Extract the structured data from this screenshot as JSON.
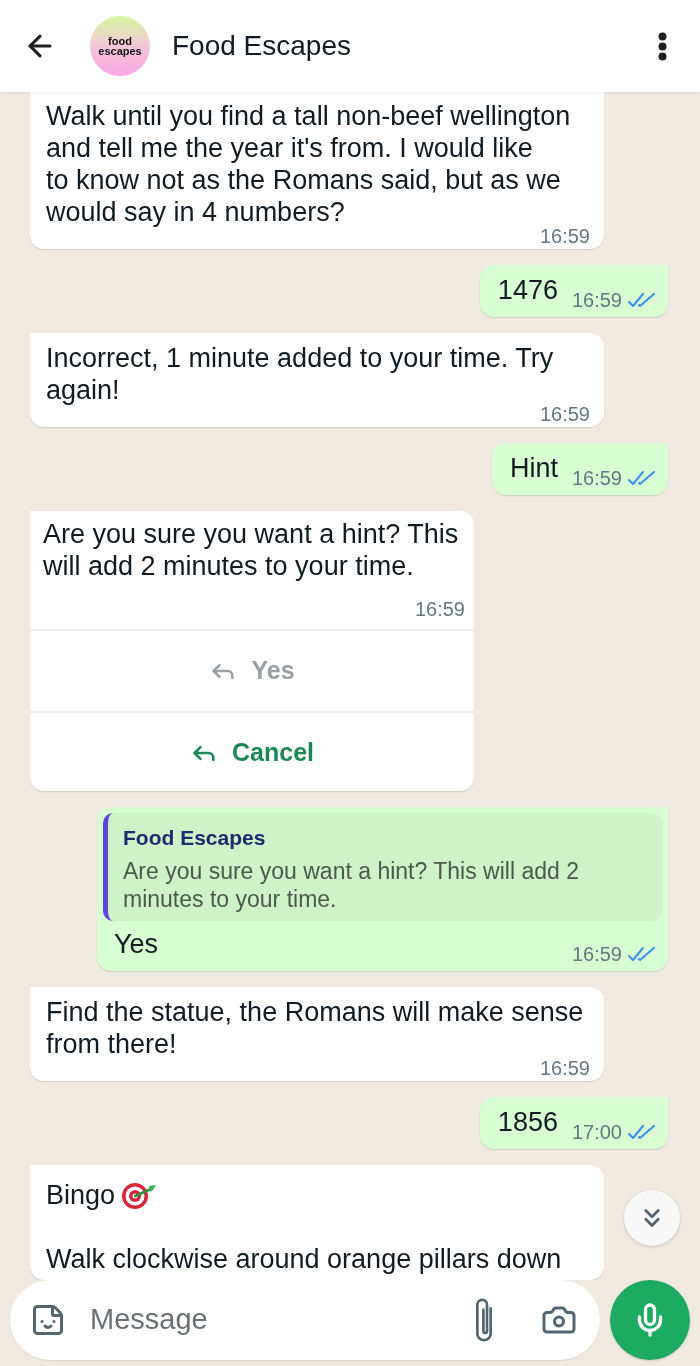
{
  "header": {
    "title": "Food Escapes",
    "avatar": {
      "text": "food escapes"
    }
  },
  "messages": [
    {
      "kind": "incoming",
      "text": "Walk until you find a tall non-beef wellington and tell me the year it's from. I would like\nto know not as the Romans said, but as we would say in 4 numbers?",
      "time": "16:59"
    },
    {
      "kind": "outgoing",
      "text": "1476",
      "time": "16:59",
      "read": true
    },
    {
      "kind": "incoming",
      "text": "Incorrect, 1 minute added to your time. Try again!",
      "time": "16:59"
    },
    {
      "kind": "outgoing",
      "text": "Hint",
      "time": "16:59",
      "read": true
    },
    {
      "kind": "buttons",
      "text": "Are you sure you want a hint? This will add 2 minutes to your time.",
      "time": "16:59",
      "buttons": [
        {
          "label": "Yes",
          "disabled": true
        },
        {
          "label": "Cancel",
          "disabled": false
        }
      ]
    },
    {
      "kind": "reply",
      "quote": {
        "author": "Food Escapes",
        "text": "Are you sure you want a hint? This will add 2 minutes to your time."
      },
      "text": "Yes",
      "time": "16:59",
      "read": true
    },
    {
      "kind": "incoming",
      "text": "Find the statue, the Romans will make sense from there!",
      "time": "16:59"
    },
    {
      "kind": "outgoing",
      "text": "1856",
      "time": "17:00",
      "read": true
    },
    {
      "kind": "incoming",
      "paragraphs": [
        {
          "text": "Bingo",
          "emoji": true
        },
        {
          "text": "Walk clockwise around orange pillars down"
        }
      ]
    }
  ],
  "composer": {
    "placeholder": "Message"
  }
}
